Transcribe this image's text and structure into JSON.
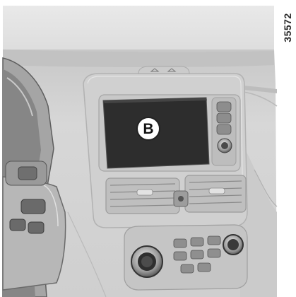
{
  "figure": {
    "reference_number": "35572",
    "callouts": [
      {
        "label": "B",
        "target": "multimedia-screen"
      }
    ]
  },
  "colors": {
    "background": "#ffffff",
    "dashboard": "#d3d3d3",
    "dashboard_dark": "#b4b4b4",
    "screen": "#2d2d2d",
    "bezel": "#c9c9c9",
    "steering_wheel": "#8f8f8f"
  }
}
